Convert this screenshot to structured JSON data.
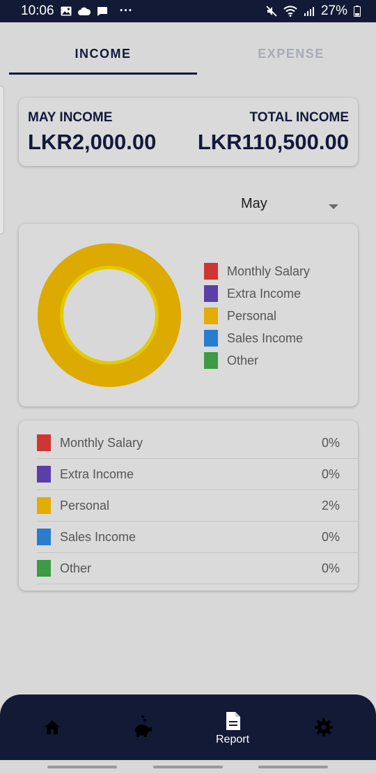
{
  "status_bar": {
    "time": "10:06",
    "overflow": "···",
    "battery": "27%",
    "icons_left": [
      "gallery-icon",
      "cloud-icon",
      "message-icon"
    ],
    "icons_right": [
      "mute-icon",
      "wifi-icon",
      "signal-icon",
      "battery-icon"
    ]
  },
  "tabs": [
    {
      "label": "INCOME",
      "active": true
    },
    {
      "label": "EXPENSE",
      "active": false
    }
  ],
  "summary": {
    "month_label": "MAY INCOME",
    "month_value": "LKR2,000.00",
    "total_label": "TOTAL INCOME",
    "total_value": "LKR110,500.00"
  },
  "month_select": {
    "value": "May"
  },
  "categories": [
    {
      "label": "Monthly Salary",
      "percent": "0%",
      "color": "#d03535"
    },
    {
      "label": "Extra Income",
      "percent": "0%",
      "color": "#5a3fa8"
    },
    {
      "label": "Personal",
      "percent": "2%",
      "color": "#e3ac00"
    },
    {
      "label": "Sales Income",
      "percent": "0%",
      "color": "#2a7ccf"
    },
    {
      "label": "Other",
      "percent": "0%",
      "color": "#3d9a45"
    }
  ],
  "chart_data": {
    "type": "pie",
    "style": "donut",
    "categories": [
      "Monthly Salary",
      "Extra Income",
      "Personal",
      "Sales Income",
      "Other"
    ],
    "values": [
      0,
      0,
      2,
      0,
      0
    ],
    "colors": [
      "#d03535",
      "#5a3fa8",
      "#e3ac00",
      "#2a7ccf",
      "#3d9a45"
    ],
    "legend": "right"
  },
  "bottom_nav": [
    {
      "icon": "home-icon",
      "label": ""
    },
    {
      "icon": "piggy-bank-icon",
      "label": ""
    },
    {
      "icon": "report-icon",
      "label": "Report",
      "active": true
    },
    {
      "icon": "gear-icon",
      "label": ""
    }
  ],
  "colors": {
    "navy": "#131a36",
    "background": "#d8d8d8",
    "inactive_tab": "#a9acb6",
    "donut_fill": "#dcaa00",
    "donut_inner_ring": "#e2c900"
  }
}
